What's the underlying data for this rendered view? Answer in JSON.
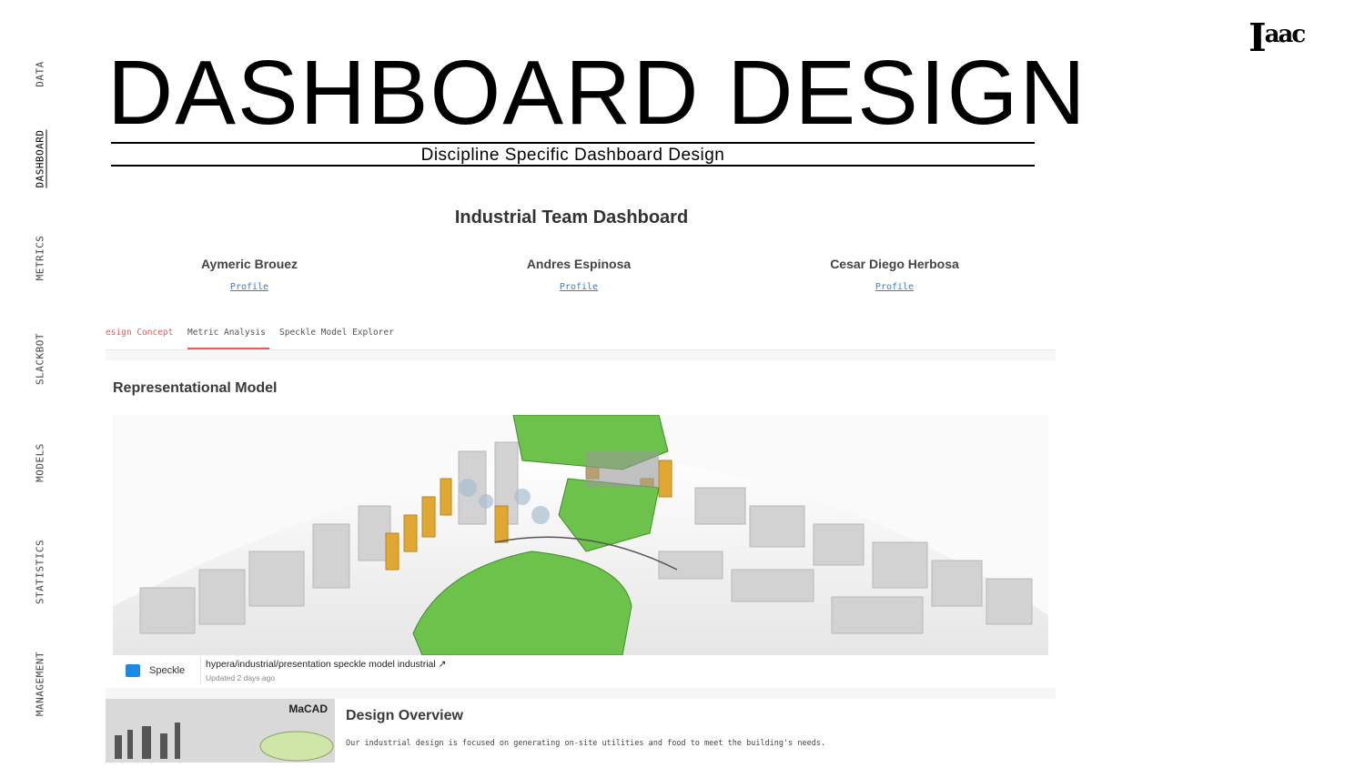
{
  "nav": {
    "items": [
      {
        "label": "DATA",
        "active": false
      },
      {
        "label": "DASHBOARD",
        "active": true
      },
      {
        "label": "METRICS",
        "active": false
      },
      {
        "label": "SLACKBOT",
        "active": false
      },
      {
        "label": "MODELS",
        "active": false
      },
      {
        "label": "STATISTICS",
        "active": false
      },
      {
        "label": "MANAGEMENT",
        "active": false
      }
    ]
  },
  "logo": {
    "main": "I",
    "sup": "aac"
  },
  "header": {
    "title": "DASHBOARD DESIGN",
    "subtitle": "Discipline Specific Dashboard Design"
  },
  "dashboard": {
    "title": "Industrial Team Dashboard",
    "members": [
      {
        "name": "Aymeric Brouez",
        "link": "Profile"
      },
      {
        "name": "Andres Espinosa",
        "link": "Profile"
      },
      {
        "name": "Cesar Diego Herbosa",
        "link": "Profile"
      }
    ],
    "tabs": [
      {
        "label": "esign Concept",
        "active": false
      },
      {
        "label": "Metric Analysis",
        "active": true
      },
      {
        "label": "Speckle Model Explorer",
        "active": false
      }
    ],
    "model_section": {
      "title": "Representational Model",
      "speckle_label": "Speckle",
      "model_path": "hypera/industrial/presentation speckle model industrial ↗",
      "updated": "Updated 2 days ago"
    },
    "overview": {
      "badge": "MaCAD",
      "title": "Design Overview",
      "text": "Our industrial design is focused on generating on-site utilities and food to meet the building's needs."
    }
  },
  "colors": {
    "accent_red": "#e35b5b",
    "link_blue": "#3b7dbf",
    "speckle_blue": "#1e88e5",
    "model_green": "#6cc24a",
    "model_orange": "#e0a832"
  }
}
